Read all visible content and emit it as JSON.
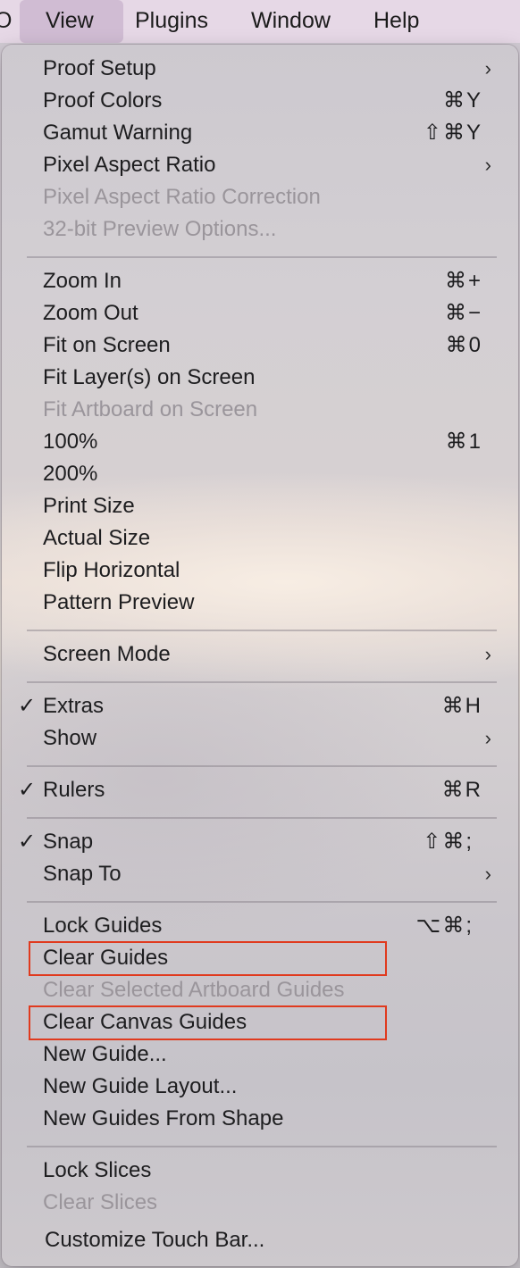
{
  "menubar": {
    "partial_item": "O",
    "items": [
      "View",
      "Plugins",
      "Window",
      "Help"
    ],
    "active": "View"
  },
  "menu": {
    "items": [
      {
        "label": "Proof Setup",
        "shortcut": "",
        "submenu": true,
        "disabled": false,
        "checked": false
      },
      {
        "label": "Proof Colors",
        "shortcut": "⌘Y",
        "submenu": false,
        "disabled": false,
        "checked": false
      },
      {
        "label": "Gamut Warning",
        "shortcut": "⇧⌘Y",
        "submenu": false,
        "disabled": false,
        "checked": false
      },
      {
        "label": "Pixel Aspect Ratio",
        "shortcut": "",
        "submenu": true,
        "disabled": false,
        "checked": false
      },
      {
        "label": "Pixel Aspect Ratio Correction",
        "shortcut": "",
        "submenu": false,
        "disabled": true,
        "checked": false
      },
      {
        "label": "32-bit Preview Options...",
        "shortcut": "",
        "submenu": false,
        "disabled": true,
        "checked": false
      },
      {
        "label": "Zoom In",
        "shortcut": "⌘+",
        "submenu": false,
        "disabled": false,
        "checked": false
      },
      {
        "label": "Zoom Out",
        "shortcut": "⌘−",
        "submenu": false,
        "disabled": false,
        "checked": false
      },
      {
        "label": "Fit on Screen",
        "shortcut": "⌘0",
        "submenu": false,
        "disabled": false,
        "checked": false
      },
      {
        "label": "Fit Layer(s) on Screen",
        "shortcut": "",
        "submenu": false,
        "disabled": false,
        "checked": false
      },
      {
        "label": "Fit Artboard on Screen",
        "shortcut": "",
        "submenu": false,
        "disabled": true,
        "checked": false
      },
      {
        "label": "100%",
        "shortcut": "⌘1",
        "submenu": false,
        "disabled": false,
        "checked": false
      },
      {
        "label": "200%",
        "shortcut": "",
        "submenu": false,
        "disabled": false,
        "checked": false
      },
      {
        "label": "Print Size",
        "shortcut": "",
        "submenu": false,
        "disabled": false,
        "checked": false
      },
      {
        "label": "Actual Size",
        "shortcut": "",
        "submenu": false,
        "disabled": false,
        "checked": false
      },
      {
        "label": "Flip Horizontal",
        "shortcut": "",
        "submenu": false,
        "disabled": false,
        "checked": false
      },
      {
        "label": "Pattern Preview",
        "shortcut": "",
        "submenu": false,
        "disabled": false,
        "checked": false
      },
      {
        "label": "Screen Mode",
        "shortcut": "",
        "submenu": true,
        "disabled": false,
        "checked": false
      },
      {
        "label": "Extras",
        "shortcut": "⌘H",
        "submenu": false,
        "disabled": false,
        "checked": true
      },
      {
        "label": "Show",
        "shortcut": "",
        "submenu": true,
        "disabled": false,
        "checked": false
      },
      {
        "label": "Rulers",
        "shortcut": "⌘R",
        "submenu": false,
        "disabled": false,
        "checked": true
      },
      {
        "label": "Snap",
        "shortcut": "⇧⌘;",
        "submenu": false,
        "disabled": false,
        "checked": true
      },
      {
        "label": "Snap To",
        "shortcut": "",
        "submenu": true,
        "disabled": false,
        "checked": false
      },
      {
        "label": "Lock Guides",
        "shortcut": "⌥⌘;",
        "submenu": false,
        "disabled": false,
        "checked": false
      },
      {
        "label": "Clear Guides",
        "shortcut": "",
        "submenu": false,
        "disabled": false,
        "checked": false,
        "highlighted": true
      },
      {
        "label": "Clear Selected Artboard Guides",
        "shortcut": "",
        "submenu": false,
        "disabled": true,
        "checked": false
      },
      {
        "label": "Clear Canvas Guides",
        "shortcut": "",
        "submenu": false,
        "disabled": false,
        "checked": false,
        "highlighted": true
      },
      {
        "label": "New Guide...",
        "shortcut": "",
        "submenu": false,
        "disabled": false,
        "checked": false
      },
      {
        "label": "New Guide Layout...",
        "shortcut": "",
        "submenu": false,
        "disabled": false,
        "checked": false
      },
      {
        "label": "New Guides From Shape",
        "shortcut": "",
        "submenu": false,
        "disabled": false,
        "checked": false
      },
      {
        "label": "Lock Slices",
        "shortcut": "",
        "submenu": false,
        "disabled": false,
        "checked": false
      },
      {
        "label": "Clear Slices",
        "shortcut": "",
        "submenu": false,
        "disabled": true,
        "checked": false
      },
      {
        "label": "Customize Touch Bar...",
        "shortcut": "",
        "submenu": false,
        "disabled": false,
        "checked": false
      }
    ],
    "check_glyph": "✓",
    "submenu_glyph": "›",
    "highlight_color": "#e03a1e"
  }
}
